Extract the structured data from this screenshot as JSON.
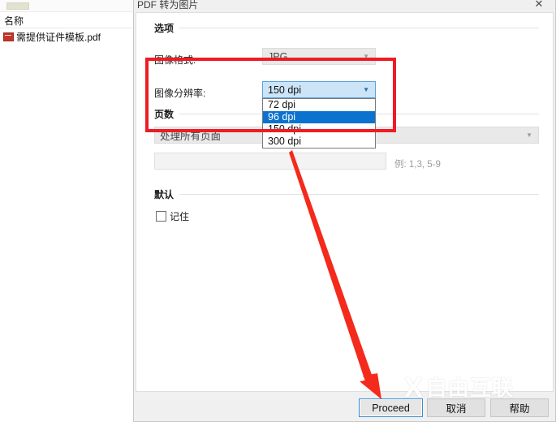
{
  "explorer": {
    "column_header": "名称",
    "file": {
      "name": "需提供证件模板.pdf",
      "icon": "pdf-file-icon"
    }
  },
  "dialog": {
    "title": "PDF 转为图片",
    "close_icon": "close-icon",
    "sections": {
      "options": {
        "header": "选项",
        "image_format": {
          "label": "图像格式:",
          "value": "JPG",
          "arrow_icon": "chevron-down-icon",
          "enabled": false
        },
        "image_resolution": {
          "label": "图像分辨率:",
          "value": "150 dpi",
          "arrow_icon": "chevron-down-icon",
          "expanded": true,
          "options": [
            "72 dpi",
            "96 dpi",
            "150 dpi",
            "300 dpi"
          ],
          "highlighted_option": "96 dpi"
        }
      },
      "pages": {
        "header": "页数",
        "range_mode": "处理所有页面",
        "arrow_icon": "chevron-down-icon",
        "custom_range_value": "",
        "hint": "例: 1,3, 5-9"
      },
      "defaults": {
        "header": "默认",
        "remember_label": "记住",
        "remember_checked": false
      }
    },
    "buttons": {
      "proceed": "Proceed",
      "cancel": "取消",
      "help": "帮助"
    }
  },
  "watermark": {
    "logo": "X",
    "text": "自由互联"
  },
  "annotations": {
    "highlight_box_color": "#ed1c24",
    "arrow_color": "#f42a1c",
    "selection_color": "#0b72cf"
  }
}
